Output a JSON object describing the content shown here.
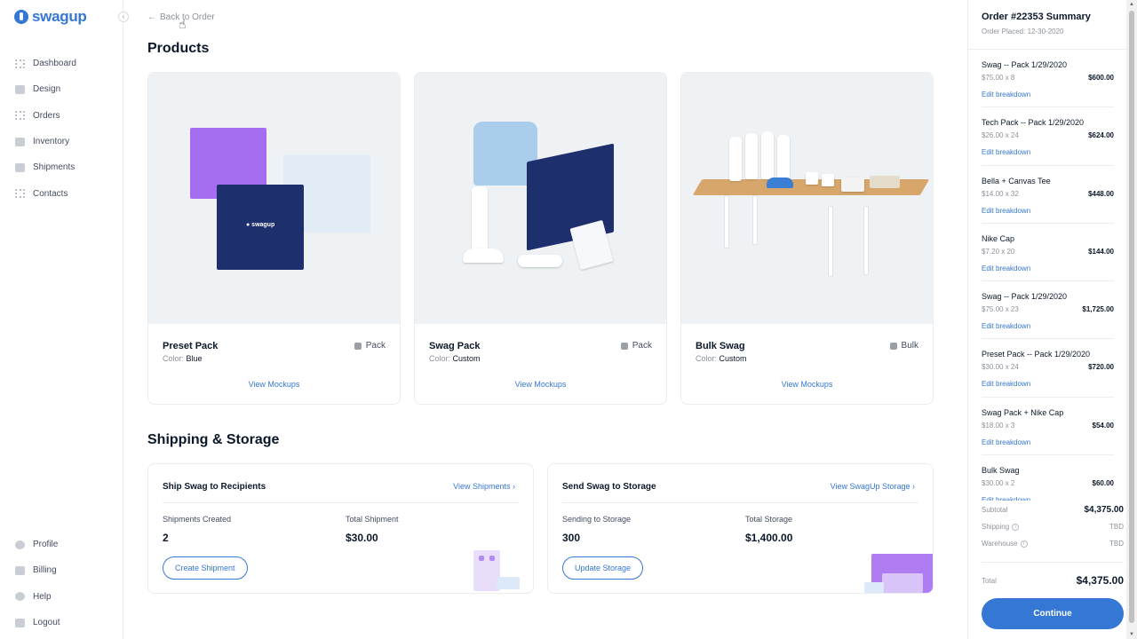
{
  "brand": {
    "name": "swagup",
    "accent": "#3577d4"
  },
  "sidebar": {
    "collapse_icon": "‹",
    "nav": [
      {
        "label": "Dashboard",
        "icon": "dashboard-icon"
      },
      {
        "label": "Design",
        "icon": "design-icon"
      },
      {
        "label": "Orders",
        "icon": "orders-icon"
      },
      {
        "label": "Inventory",
        "icon": "inventory-icon"
      },
      {
        "label": "Shipments",
        "icon": "shipments-icon"
      },
      {
        "label": "Contacts",
        "icon": "contacts-icon"
      }
    ],
    "bottom_nav": [
      {
        "label": "Profile",
        "icon": "profile-icon"
      },
      {
        "label": "Billing",
        "icon": "billing-icon"
      },
      {
        "label": "Help",
        "icon": "help-icon"
      },
      {
        "label": "Logout",
        "icon": "logout-icon"
      }
    ]
  },
  "main": {
    "back_link": "Back to Order",
    "products_heading": "Products",
    "products": [
      {
        "name": "Preset Pack",
        "type": "Pack",
        "color_label": "Color:",
        "color": "Blue",
        "action": "View Mockups"
      },
      {
        "name": "Swag Pack",
        "type": "Pack",
        "color_label": "Color:",
        "color": "Custom",
        "action": "View Mockups"
      },
      {
        "name": "Bulk Swag",
        "type": "Bulk",
        "color_label": "Color:",
        "color": "Custom",
        "action": "View Mockups"
      }
    ],
    "shipping_heading": "Shipping & Storage",
    "shipping_cards": [
      {
        "title": "Ship Swag to Recipients",
        "link": "View Shipments ›",
        "stat1_label": "Shipments Created",
        "stat1_value": "2",
        "stat2_label": "Total Shipment",
        "stat2_value": "$30.00",
        "button": "Create Shipment"
      },
      {
        "title": "Send Swag to Storage",
        "link": "View SwagUp Storage ›",
        "stat1_label": "Sending to Storage",
        "stat1_value": "300",
        "stat2_label": "Total Storage",
        "stat2_value": "$1,400.00",
        "button": "Update Storage"
      }
    ]
  },
  "summary": {
    "title": "Order #22353 Summary",
    "placed": "Order Placed: 12-30-2020",
    "edit_label": "Edit breakdown",
    "items": [
      {
        "name": "Swag -- Pack 1/29/2020",
        "qty": "$75.00 x 8",
        "total": "$600.00"
      },
      {
        "name": "Tech Pack -- Pack 1/29/2020",
        "qty": "$26.00 x 24",
        "total": "$624.00"
      },
      {
        "name": "Bella + Canvas Tee",
        "qty": "$14.00 x 32",
        "total": "$448.00"
      },
      {
        "name": "Nike Cap",
        "qty": "$7.20 x 20",
        "total": "$144.00"
      },
      {
        "name": "Swag -- Pack 1/29/2020",
        "qty": "$75.00 x 23",
        "total": "$1,725.00"
      },
      {
        "name": "Preset Pack -- Pack 1/29/2020",
        "qty": "$30.00 x 24",
        "total": "$720.00"
      },
      {
        "name": "Swag Pack + Nike Cap",
        "qty": "$18.00 x 3",
        "total": "$54.00"
      },
      {
        "name": "Bulk Swag",
        "qty": "$30.00 x 2",
        "total": "$60.00"
      }
    ],
    "subtotal_label": "Subtotal",
    "subtotal": "$4,375.00",
    "shipping_label": "Shipping",
    "shipping": "TBD",
    "warehouse_label": "Warehouse",
    "warehouse": "TBD",
    "total_label": "Total",
    "total": "$4,375.00",
    "continue": "Continue"
  }
}
